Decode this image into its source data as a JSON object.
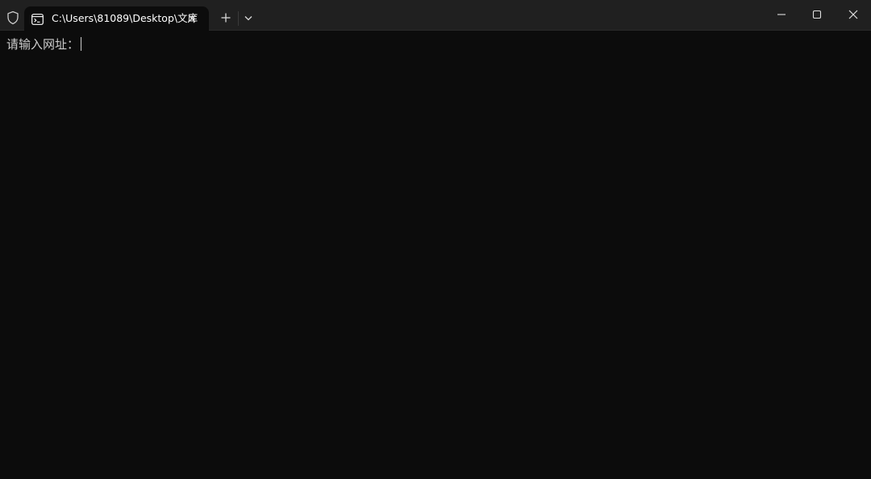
{
  "tab": {
    "title": "C:\\Users\\81089\\Desktop\\文库",
    "icon": "terminal-icon"
  },
  "titlebar": {
    "left_icon": "shield-icon",
    "new_tab_icon": "plus-icon",
    "dropdown_icon": "chevron-down-icon",
    "minimize_icon": "minimize-icon",
    "maximize_icon": "maximize-icon",
    "close_icon": "close-icon"
  },
  "console": {
    "prompt": "请输入网址："
  },
  "colors": {
    "titlebar_bg": "#202020",
    "console_bg": "#0c0c0c",
    "text": "#cccccc",
    "tab_text": "#ffffff"
  }
}
